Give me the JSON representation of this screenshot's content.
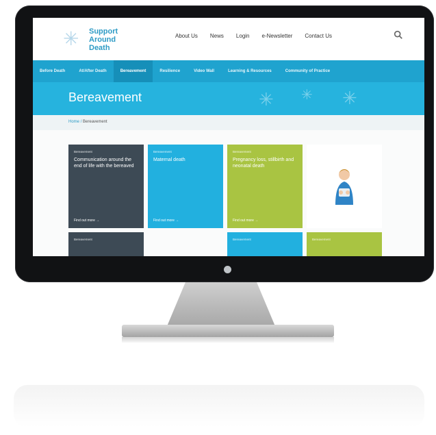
{
  "site": {
    "logo_lines": [
      "Support",
      "Around",
      "Death"
    ],
    "top_links": [
      "About Us",
      "News",
      "Login",
      "e-Newsletter",
      "Contact Us"
    ],
    "search_icon": "search-icon"
  },
  "nav": {
    "items": [
      "Before Death",
      "At/After Death",
      "Bereavement",
      "Resilience",
      "Video Wall",
      "Learning & Resources",
      "Community of Practice"
    ],
    "active": "Bereavement"
  },
  "hero": {
    "title": "Bereavement"
  },
  "breadcrumb": {
    "home": "Home",
    "sep": "/",
    "current": "Bereavement"
  },
  "tiles": [
    {
      "category": "Bereavement",
      "title": "Communication around the end of life with the bereaved",
      "more": "Find out more →"
    },
    {
      "category": "Bereavement",
      "title": "Maternal death",
      "more": "Find out more →"
    },
    {
      "category": "Bereavement",
      "title": "Pregnancy loss, stillbirth and neonatal death",
      "more": "Find out more →"
    }
  ],
  "bottom_tiles": [
    {
      "category": "Bereavement"
    },
    {
      "category": "Bereavement"
    },
    {
      "category": "Bereavement"
    }
  ],
  "colors": {
    "nav": "#1fa3cf",
    "hero": "#26b3de",
    "tile_dark": "#3d4a55",
    "tile_blue": "#22b0df",
    "tile_green": "#a9c442"
  }
}
